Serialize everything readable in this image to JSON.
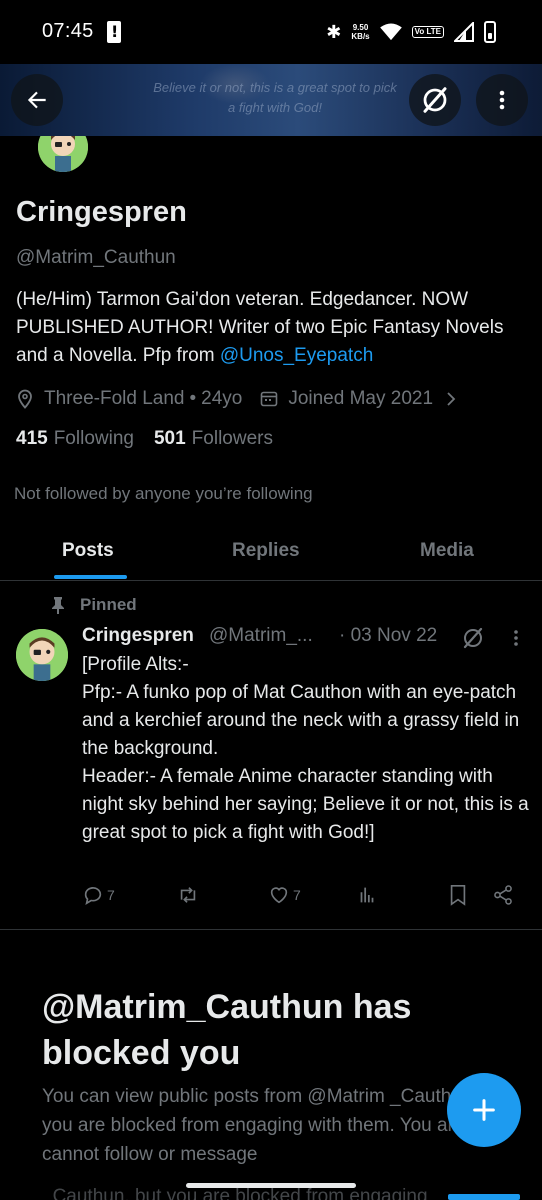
{
  "status_bar": {
    "time": "07:45",
    "net_speed_value": "9.50",
    "net_speed_unit": "KB/s",
    "volte": "Vo LTE",
    "icons": [
      "alert-icon",
      "bluetooth-icon",
      "wifi-icon",
      "signal-icon",
      "battery-icon"
    ]
  },
  "header": {
    "banner_text": "Believe it or not, this is a great spot to pick a fight with God!",
    "icons": [
      "back-arrow-icon",
      "grok-icon",
      "more-vertical-icon"
    ]
  },
  "profile": {
    "display_name": "Cringespren",
    "handle": "@Matrim_Cauthun",
    "bio_text": "(He/Him) Tarmon Gai'don veteran. Edgedancer. NOW PUBLISHED AUTHOR! Writer of two Epic Fantasy Novels and a Novella. Pfp from ",
    "bio_mention": "@Unos_Eyepatch",
    "location": "Three-Fold Land",
    "age": "24yo",
    "location_separator": "•",
    "joined": "Joined May 2021",
    "following_count": "415",
    "following_label": "Following",
    "followers_count": "501",
    "followers_label": "Followers",
    "not_followed_text": "Not followed by anyone you’re following"
  },
  "tabs": [
    {
      "label": "Posts",
      "active": true
    },
    {
      "label": "Replies",
      "active": false
    },
    {
      "label": "Media",
      "active": false
    }
  ],
  "pinned_tweet": {
    "pinned_label": "Pinned",
    "name": "Cringespren",
    "handle": "@Matrim_...",
    "date": "· 03 Nov 22",
    "text": "[Profile Alts:-\nPfp:- A funko pop of Mat Cauthon with an eye-patch and a kerchief around the neck with a grassy field in the background.\nHeader:- A female Anime character standing with night sky behind her saying; Believe it or not, this is a great spot to pick a fight with God!]",
    "reply_count": "7",
    "like_count": "7"
  },
  "blocked": {
    "title": "@Matrim_Cauthun has blocked you",
    "description": "You can view public posts from @Matrim _Cauthun, but you are blocked from engaging with them. You also cannot follow or message",
    "description_partial": "_Cauthun, but you are blocked from engaging"
  },
  "colors": {
    "background": "#000000",
    "accent": "#1d9bf0",
    "text_primary": "#e7e9ea",
    "text_secondary": "#71767b",
    "divider": "#2f3336"
  }
}
